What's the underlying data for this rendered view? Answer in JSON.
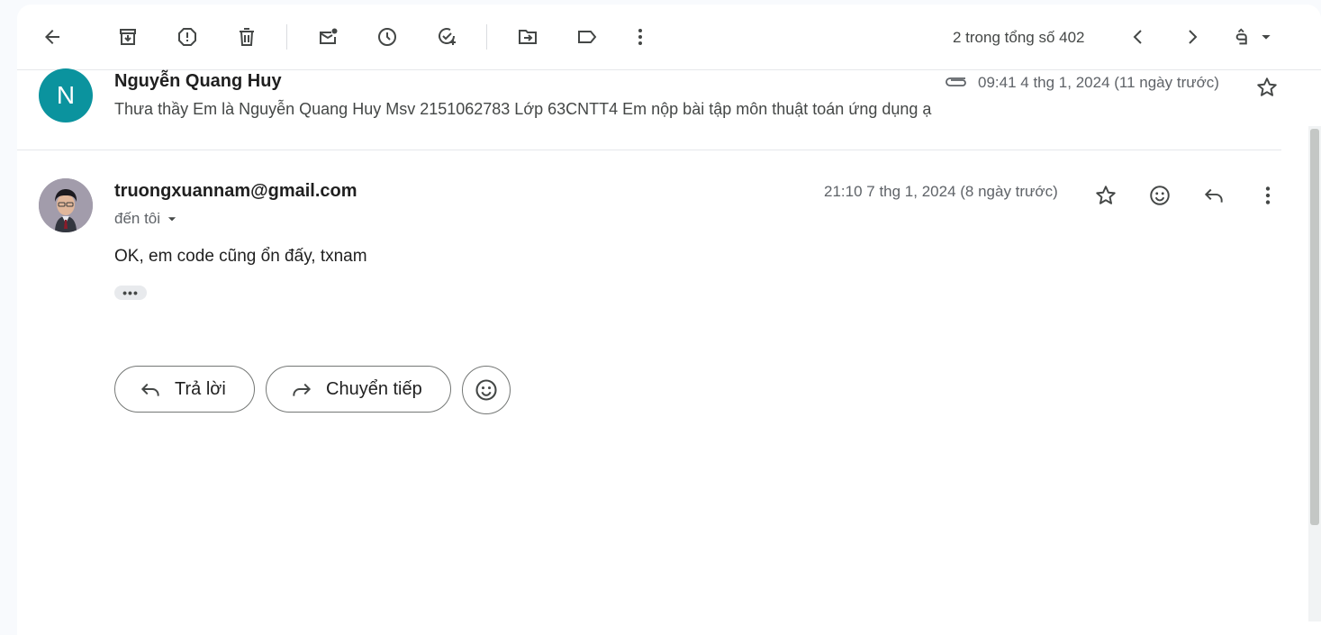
{
  "toolbar": {
    "back_icon": "arrow-back-icon",
    "counter": "2 trong tổng số 402"
  },
  "message1": {
    "avatar_letter": "N",
    "avatar_color": "#0b939e",
    "sender": "Nguyễn Quang Huy",
    "snippet": "Thưa thầy Em là Nguyễn Quang Huy Msv 2151062783 Lớp 63CNTT4 Em nộp bài tập môn thuật toán ứng dụng ạ",
    "time": "09:41 4 thg 1, 2024 (11 ngày trước)"
  },
  "message2": {
    "sender": "truongxuannam@gmail.com",
    "recipient": "đến tôi",
    "time": "21:10 7 thg 1, 2024 (8 ngày trước)",
    "body": "OK, em code cũng ổn đấy, txnam",
    "more": "•••"
  },
  "actions": {
    "reply_label": "Trả lời",
    "forward_label": "Chuyển tiếp"
  }
}
